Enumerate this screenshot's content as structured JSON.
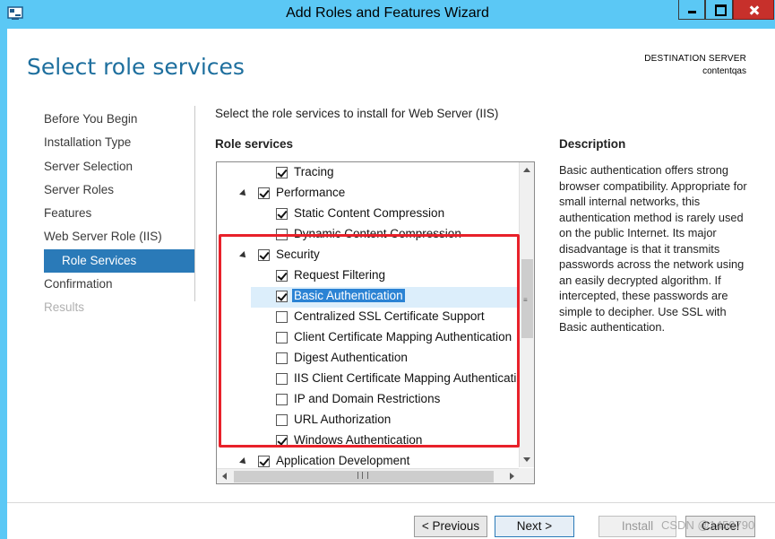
{
  "window": {
    "title": "Add Roles and Features Wizard",
    "app_icon": "server-manager-icon",
    "controls": [
      "minimize-icon",
      "maximize-icon",
      "close-icon"
    ],
    "accent_color": "#5bc8f5",
    "close_color": "#c7302b"
  },
  "header": {
    "page_title": "Select role services",
    "destination_label": "DESTINATION SERVER",
    "destination_name": "contentqas"
  },
  "nav": {
    "items": [
      {
        "label": "Before You Begin",
        "state": "normal"
      },
      {
        "label": "Installation Type",
        "state": "normal"
      },
      {
        "label": "Server Selection",
        "state": "normal"
      },
      {
        "label": "Server Roles",
        "state": "normal"
      },
      {
        "label": "Features",
        "state": "normal"
      },
      {
        "label": "Web Server Role (IIS)",
        "state": "normal"
      },
      {
        "label": "Role Services",
        "state": "active"
      },
      {
        "label": "Confirmation",
        "state": "normal"
      },
      {
        "label": "Results",
        "state": "disabled"
      }
    ],
    "active_color": "#2a7ab8"
  },
  "main": {
    "intro": "Select the role services to install for Web Server (IIS)",
    "role_services_header": "Role services",
    "tree": [
      {
        "label": "Tracing",
        "checked": true,
        "level": 2,
        "expander": false
      },
      {
        "label": "Performance",
        "checked": true,
        "level": 1,
        "expander": true
      },
      {
        "label": "Static Content Compression",
        "checked": true,
        "level": 2,
        "expander": false
      },
      {
        "label": "Dynamic Content Compression",
        "checked": false,
        "level": 2,
        "expander": false
      },
      {
        "label": "Security",
        "checked": true,
        "level": 1,
        "expander": true
      },
      {
        "label": "Request Filtering",
        "checked": true,
        "level": 2,
        "expander": false
      },
      {
        "label": "Basic Authentication",
        "checked": true,
        "level": 2,
        "expander": false,
        "selected": true
      },
      {
        "label": "Centralized SSL Certificate Support",
        "checked": false,
        "level": 2,
        "expander": false
      },
      {
        "label": "Client Certificate Mapping Authentication",
        "checked": false,
        "level": 2,
        "expander": false
      },
      {
        "label": "Digest Authentication",
        "checked": false,
        "level": 2,
        "expander": false
      },
      {
        "label": "IIS Client Certificate Mapping Authentication",
        "checked": false,
        "level": 2,
        "expander": false
      },
      {
        "label": "IP and Domain Restrictions",
        "checked": false,
        "level": 2,
        "expander": false
      },
      {
        "label": "URL Authorization",
        "checked": false,
        "level": 2,
        "expander": false
      },
      {
        "label": "Windows Authentication",
        "checked": true,
        "level": 2,
        "expander": false
      },
      {
        "label": "Application Development",
        "checked": true,
        "level": 1,
        "expander": true
      }
    ],
    "highlight_color": "#e8212a"
  },
  "description": {
    "header": "Description",
    "text": "Basic authentication offers strong browser compatibility. Appropriate for small internal networks, this authentication method is rarely used on the public Internet. Its major disadvantage is that it transmits passwords across the network using an easily decrypted algorithm. If intercepted, these passwords are simple to decipher. Use SSL with Basic authentication."
  },
  "buttons": {
    "previous": "< Previous",
    "next": "Next >",
    "install": "Install",
    "cancel": "Cancel"
  },
  "watermark": "CSDN @1450790"
}
